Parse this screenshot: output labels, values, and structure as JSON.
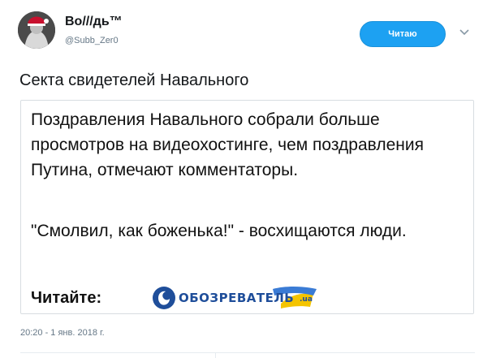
{
  "author": {
    "display_name": "Bo///дь™",
    "handle": "@Subb_Zer0"
  },
  "follow_button": {
    "label": "Читаю"
  },
  "tweet": {
    "text": "Секта свидетелей Навального",
    "timestamp": "20:20 - 1 янв. 2018 г."
  },
  "card": {
    "paragraph_1": "Поздравления Навального собрали больше просмотров на видеохостинге, чем поздравления Путина, отмечают комментаторы.",
    "paragraph_2": "\"Смолвил, как боженька!\" - восхищаются люди.",
    "read_label": "Читайте:",
    "source_logo_text": "ОБОЗРЕВАТЕЛЬ",
    "source_logo_suffix": ".ua"
  },
  "icons": {
    "avatar": "avatar-icon",
    "caret": "chevron-down-icon",
    "logo": "obozrevatel-logo-icon"
  },
  "colors": {
    "accent": "#1da1f2",
    "muted": "#657786",
    "logo_blue": "#1f4e9a",
    "logo_yellow": "#f4c400"
  }
}
